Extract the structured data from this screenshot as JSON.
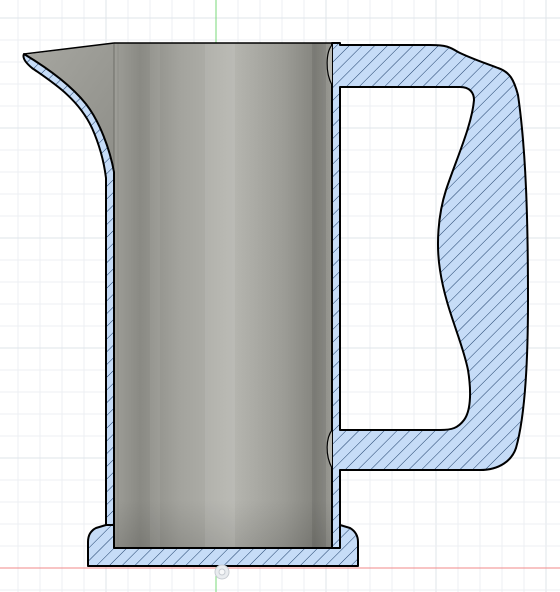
{
  "canvas": {
    "background": "#ffffff",
    "grid_minor_color": "#eceff3",
    "grid_major_color": "#dfe4ea",
    "axis_y_color": "#7ad97a",
    "axis_x_color": "#f08a8a"
  },
  "model": {
    "section_fill": "#c6dcf7",
    "section_hatch": "#1e3f6a",
    "outline": "#000000",
    "interior_dark": "#8b8b85",
    "interior_light": "#b3b3ad"
  },
  "icons": {
    "origin": "origin-point-icon"
  }
}
